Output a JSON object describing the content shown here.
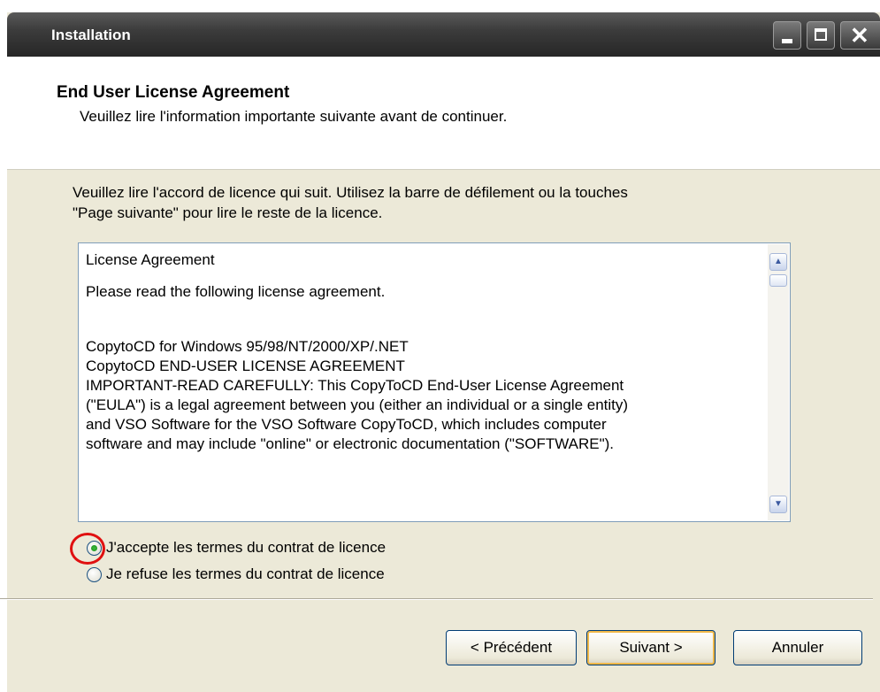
{
  "window": {
    "title": "Installation",
    "controls": [
      "minimize-icon",
      "maximize-icon",
      "close-icon"
    ]
  },
  "header": {
    "title": "End User License Agreement",
    "subtitle": "Veuillez lire l'information importante suivante avant de continuer."
  },
  "intro": {
    "line1": "Veuillez lire l'accord de licence qui suit. Utilisez la barre de défilement ou la touches",
    "line2": "\"Page suivante\" pour lire le reste de la licence."
  },
  "license": {
    "lines": [
      "License Agreement",
      "Please read the following license agreement.",
      "CopytoCD for Windows 95/98/NT/2000/XP/.NET",
      "CopytoCD END-USER LICENSE AGREEMENT",
      "IMPORTANT-READ CAREFULLY: This CopyToCD End-User License Agreement",
      "(\"EULA\") is a legal agreement between you (either an individual or a single entity)",
      "and VSO Software for the VSO Software CopyToCD, which includes computer",
      "software and may include \"online\" or electronic documentation (\"SOFTWARE\")."
    ],
    "scrollbar": {
      "up_icon": "chevron-up-icon",
      "down_icon": "chevron-down-icon"
    }
  },
  "options": {
    "accept_label": "J'accepte les termes du contrat de licence",
    "refuse_label": "Je refuse les termes du contrat de licence",
    "selected": "accept"
  },
  "buttons": {
    "back": "< Précédent",
    "next": "Suivant >",
    "cancel": "Annuler"
  },
  "colors": {
    "titlebar": "#3c3c3c",
    "dialog_bg": "#ece9d8",
    "highlight": "#e01010"
  }
}
